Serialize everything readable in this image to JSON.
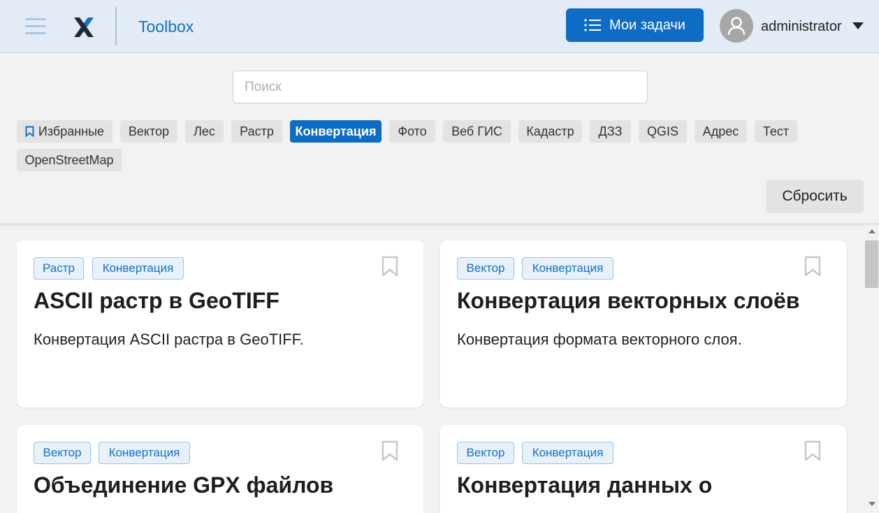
{
  "header": {
    "app_title": "Toolbox",
    "tasks_button_label": "Мои задачи",
    "username": "administrator",
    "accent_color": "#0f6cc4"
  },
  "search": {
    "placeholder": "Поиск",
    "value": ""
  },
  "filters": {
    "favorites_label": "Избранные",
    "chips": [
      "Вектор",
      "Лес",
      "Растр",
      "Конвертация",
      "Фото",
      "Веб ГИС",
      "Кадастр",
      "ДЗЗ",
      "QGIS",
      "Адрес",
      "Тест",
      "OpenStreetMap"
    ],
    "active": "Конвертация",
    "reset_label": "Сбросить"
  },
  "cards": [
    {
      "tags": [
        "Растр",
        "Конвертация"
      ],
      "title": "ASCII растр в GeoTIFF",
      "description": "Конвертация ASCII растра в GeoTIFF."
    },
    {
      "tags": [
        "Вектор",
        "Конвертация"
      ],
      "title": "Конвертация векторных слоёв",
      "description": "Конвертация формата векторного слоя."
    },
    {
      "tags": [
        "Вектор",
        "Конвертация"
      ],
      "title": "Объединение GPX файлов",
      "description": ""
    },
    {
      "tags": [
        "Вектор",
        "Конвертация"
      ],
      "title": "Конвертация данных о",
      "description": ""
    }
  ],
  "icons": {
    "menu": "hamburger-icon",
    "logo": "x-logo",
    "tasks": "list-icon",
    "user": "user-icon",
    "caret": "caret-down-icon",
    "favorite": "bookmark-icon"
  }
}
